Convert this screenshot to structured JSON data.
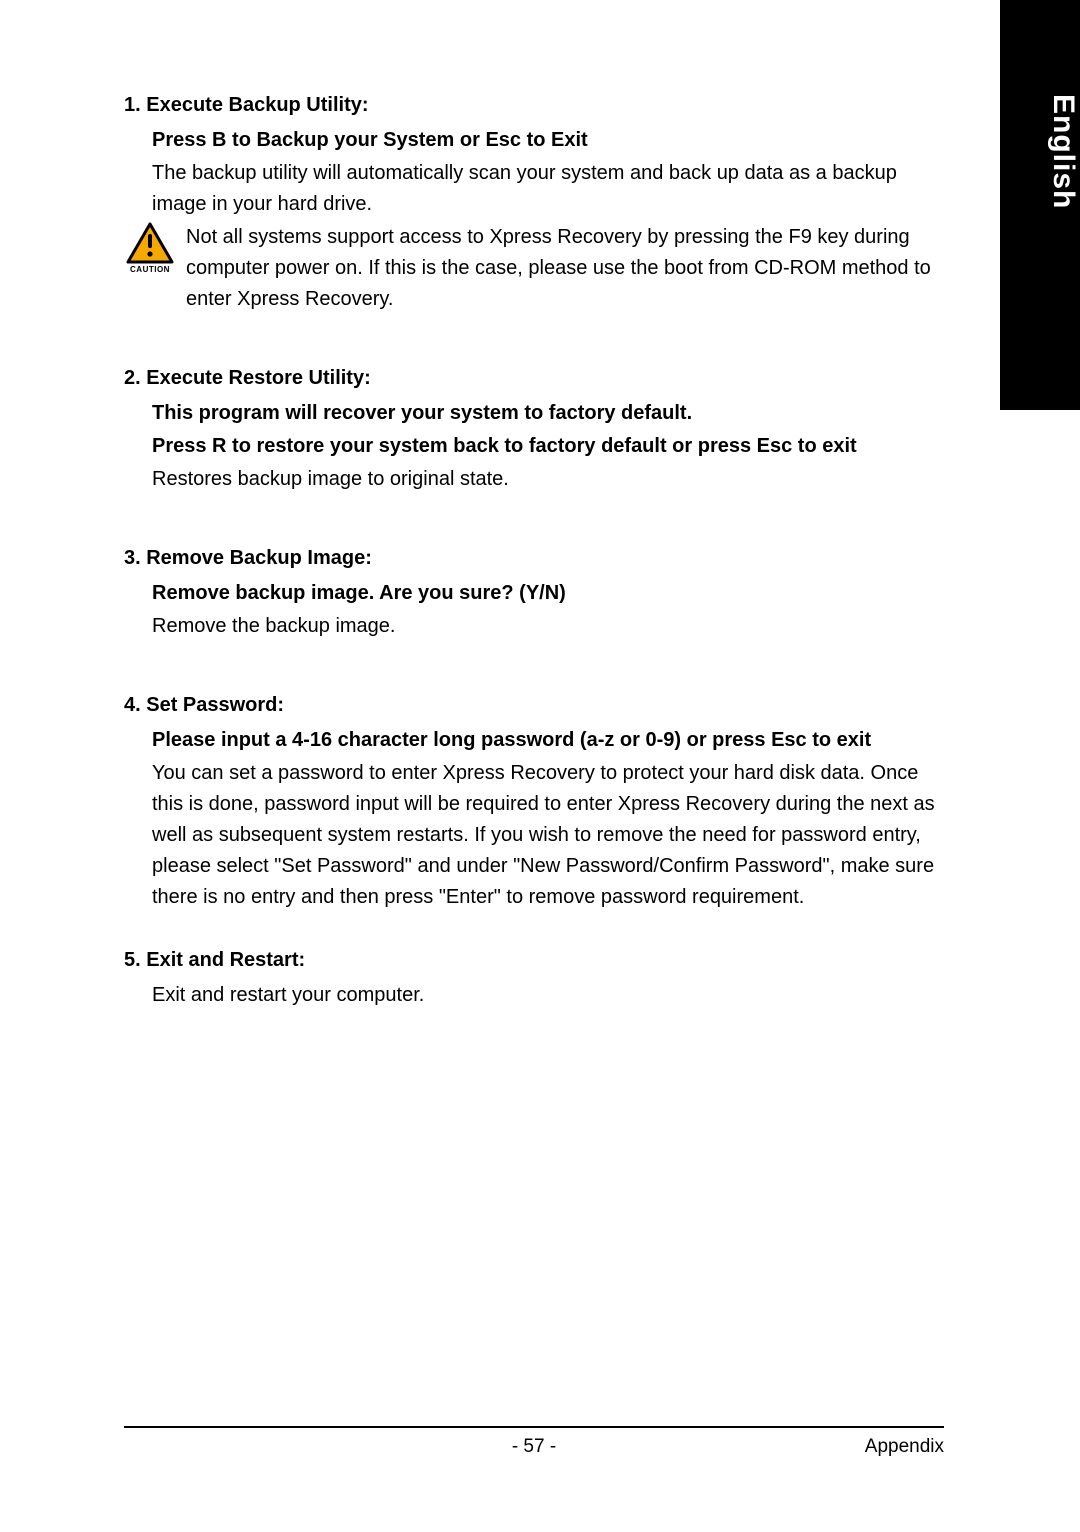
{
  "side_tab": {
    "language": "English"
  },
  "sections": [
    {
      "heading": "1. Execute Backup Utility:",
      "subheading": "Press B to Backup your System or Esc to Exit",
      "body": "The backup utility will automatically scan your system and back up data as a backup image in your hard drive.",
      "caution": {
        "label": "CAUTION",
        "text": "Not all systems support access to Xpress Recovery by pressing the F9 key during computer power on. If this is the case, please use the boot from CD-ROM method to enter Xpress Recovery."
      }
    },
    {
      "heading": "2. Execute Restore Utility:",
      "subheadings": [
        "This program will recover your system to factory default.",
        "Press R to restore your system back to factory default or press Esc to exit"
      ],
      "body": "Restores backup image to original state."
    },
    {
      "heading": "3. Remove Backup Image:",
      "subheading": "Remove backup image.  Are you sure?  (Y/N)",
      "body": "Remove the backup image."
    },
    {
      "heading": "4. Set Password:",
      "subheading": "Please input a 4-16 character long password (a-z or 0-9) or press Esc to exit",
      "body": "You can set a password to enter Xpress Recovery to protect your hard disk data.  Once this is done, password input will be required to enter Xpress Recovery during the next as well as subsequent system restarts.  If you wish to remove the need for password entry, please select \"Set Password\" and under \"New Password/Confirm Password\", make sure there is no entry and then press \"Enter\" to remove password requirement."
    },
    {
      "heading": "5. Exit and Restart:",
      "body": "Exit and restart your computer."
    }
  ],
  "footer": {
    "page_number": "-  57  -",
    "section_name": "Appendix"
  }
}
